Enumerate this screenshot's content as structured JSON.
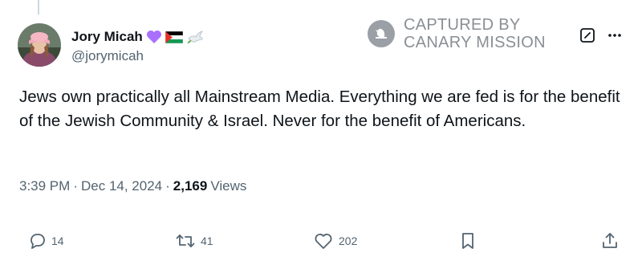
{
  "author": {
    "display_name": "Jory Micah",
    "handle": "@jorymicah",
    "emojis": [
      "purple-heart",
      "palestine-flag",
      "dove"
    ]
  },
  "watermark": {
    "line1": "CAPTURED BY",
    "line2": "CANARY MISSION"
  },
  "tweet": {
    "text": "Jews own practically all Mainstream Media. Everything we are fed is for the benefit of the Jewish Community & Israel. Never for the benefit of Americans."
  },
  "meta": {
    "time": "3:39 PM",
    "separator": "·",
    "date": "Dec 14, 2024",
    "views_count": "2,169",
    "views_label": "Views"
  },
  "actions": {
    "replies": "14",
    "reposts": "41",
    "likes": "202"
  },
  "colors": {
    "text_primary": "#0f1419",
    "text_secondary": "#536471",
    "purple_heart": "#a970ff",
    "watermark_gray": "#8a8f94"
  }
}
